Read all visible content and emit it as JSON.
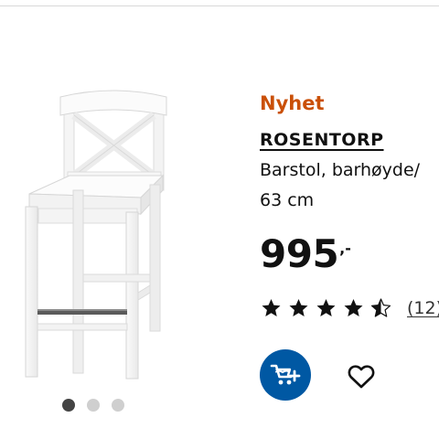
{
  "product": {
    "badge": "Nyhet",
    "name": "ROSENTORP",
    "description_lines": [
      "Barstol, barhøyde/",
      "63 cm"
    ],
    "image_icon": "bar-stool-product-image"
  },
  "price": {
    "integer": "995",
    "decimals": ",-"
  },
  "rating": {
    "value": 4.5,
    "max": 5,
    "count_label": "(12)"
  },
  "actions": {
    "add_to_cart_icon": "shopping-cart-add-icon",
    "wishlist_icon": "heart-outline-icon"
  },
  "carousel": {
    "total": 3,
    "active_index": 0
  },
  "colors": {
    "badge": "#ca5008",
    "primary": "#0058a3",
    "text": "#111111",
    "dot_active": "#444444",
    "dot_inactive": "#cfcfcf"
  }
}
